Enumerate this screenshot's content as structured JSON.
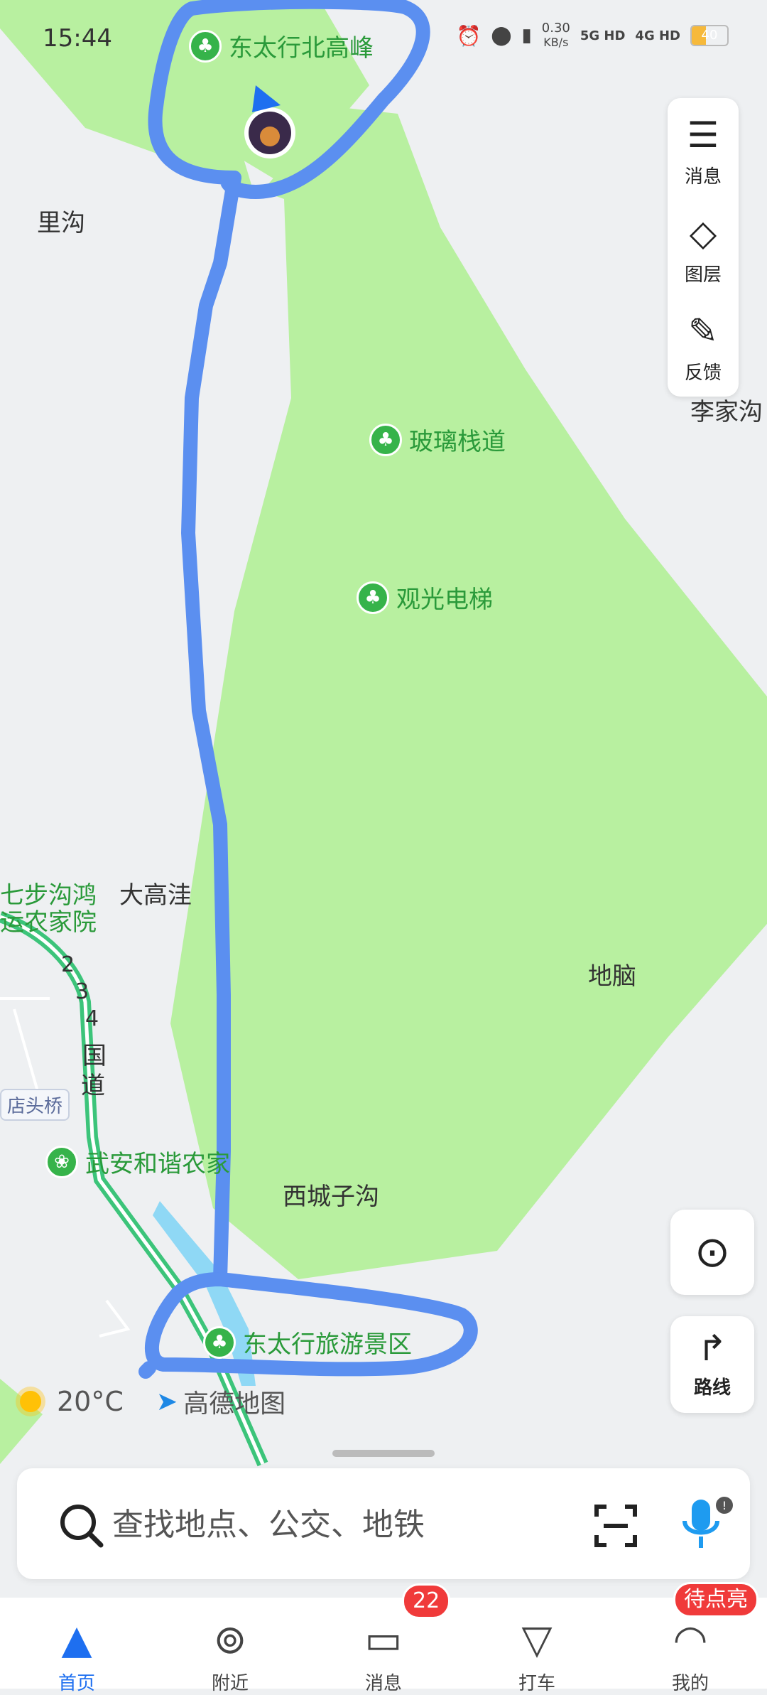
{
  "status_bar": {
    "time": "15:44",
    "net_speed": "0.30",
    "net_unit": "KB/s",
    "signal_1": "5G HD",
    "signal_2": "4G HD",
    "battery": "40",
    "battery_level_percent": 40
  },
  "map": {
    "place_labels": [
      "里沟",
      "李家沟",
      "大高洼",
      "地脑",
      "西城子沟",
      "七步沟鸿",
      "运农家院",
      "店头桥"
    ],
    "road_labels": [
      "2",
      "3",
      "4",
      "国",
      "道"
    ],
    "pois": [
      {
        "name": "东太行北高峰",
        "icon": "tree-icon"
      },
      {
        "name": "玻璃栈道",
        "icon": "tree-icon"
      },
      {
        "name": "观光电梯",
        "icon": "tree-icon"
      },
      {
        "name": "武安和谐农家",
        "icon": "cherry-icon"
      },
      {
        "name": "东太行旅游景区",
        "icon": "tree-icon"
      }
    ],
    "colors": {
      "park": "#b8f0a0",
      "drawn_route": "#5b8ff0",
      "water": "#8fd8f5",
      "road": "#3cc47a"
    }
  },
  "side_panel": {
    "messages_label": "消息",
    "layers_label": "图层",
    "feedback_label": "反馈"
  },
  "route_button_label": "路线",
  "weather": {
    "temperature": "20°C",
    "icon": "sun-icon"
  },
  "brand": "高德地图",
  "search": {
    "placeholder": "查找地点、公交、地铁"
  },
  "tabs": [
    {
      "label": "首页",
      "icon": "navigation-arrow-icon",
      "active": true
    },
    {
      "label": "附近",
      "icon": "location-pin-icon",
      "active": false
    },
    {
      "label": "消息",
      "icon": "message-icon",
      "badge": "22",
      "active": false
    },
    {
      "label": "打车",
      "icon": "taxi-icon",
      "active": false
    },
    {
      "label": "我的",
      "icon": "profile-icon",
      "badge": "待点亮",
      "active": false
    }
  ]
}
